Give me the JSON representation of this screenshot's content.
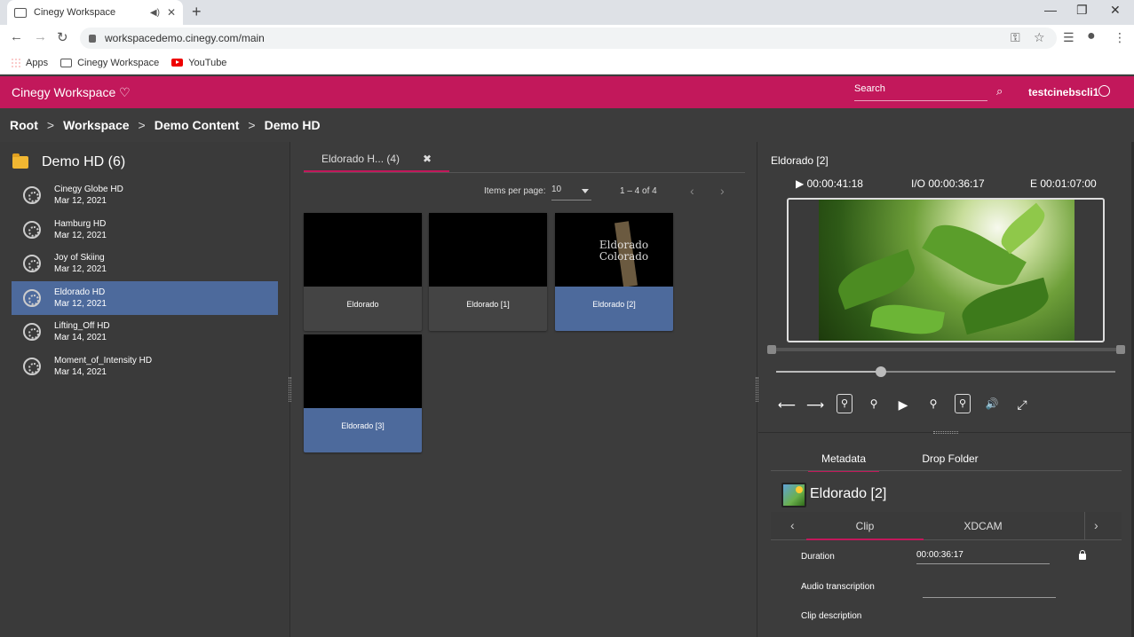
{
  "browser": {
    "tab_title": "Cinegy Workspace",
    "url": "workspacedemo.cinegy.com/main",
    "bookmarks": [
      "Apps",
      "Cinegy Workspace",
      "YouTube"
    ]
  },
  "app": {
    "brand": "Cinegy Workspace ♡",
    "search_placeholder": "Search",
    "user": "testcinebscli1",
    "accent_color": "#c2185b",
    "selection_color": "#4d6a9c"
  },
  "breadcrumb": [
    "Root",
    "Workspace",
    "Demo Content",
    "Demo HD"
  ],
  "left_panel": {
    "folder_title": "Demo HD (6)",
    "items": [
      {
        "name": "Cinegy Globe HD",
        "date": "Mar 12, 2021",
        "selected": false
      },
      {
        "name": "Hamburg HD",
        "date": "Mar 12, 2021",
        "selected": false
      },
      {
        "name": "Joy of Skiing",
        "date": "Mar 12, 2021",
        "selected": false
      },
      {
        "name": "Eldorado HD",
        "date": "Mar 12, 2021",
        "selected": true
      },
      {
        "name": "Lifting_Off HD",
        "date": "Mar 14, 2021",
        "selected": false
      },
      {
        "name": "Moment_of_Intensity HD",
        "date": "Mar 14, 2021",
        "selected": false
      }
    ]
  },
  "middle_panel": {
    "tab_label": "Eldorado H... (4)",
    "close_glyph": "✖",
    "items_per_page_label": "Items per page:",
    "items_per_page_value": "10",
    "range_label": "1 – 4 of 4",
    "cards": [
      {
        "label": "Eldorado",
        "thumb": "black",
        "selected": false
      },
      {
        "label": "Eldorado [1]",
        "thumb": "black",
        "selected": false
      },
      {
        "label": "Eldorado [2]",
        "thumb": "forest",
        "selected": true,
        "thumb_text": "Eldorado Colorado"
      },
      {
        "label": "Eldorado [3]",
        "thumb": "water",
        "selected": true
      }
    ]
  },
  "right_panel": {
    "clip_title": "Eldorado [2]",
    "timecode_play": "▶ 00:00:41:18",
    "timecode_io": "I/O 00:00:36:17",
    "timecode_end": "E 00:01:07:00",
    "playhead_fraction": 0.31,
    "tabs": [
      "Metadata",
      "Drop Folder"
    ],
    "metadata_title": "Eldorado [2]",
    "subtabs": [
      "Clip",
      "XDCAM"
    ],
    "fields": [
      {
        "label": "Duration",
        "value": "00:00:36:17"
      },
      {
        "label": "Audio transcription",
        "value": ""
      },
      {
        "label": "Clip description",
        "value": ""
      }
    ]
  }
}
